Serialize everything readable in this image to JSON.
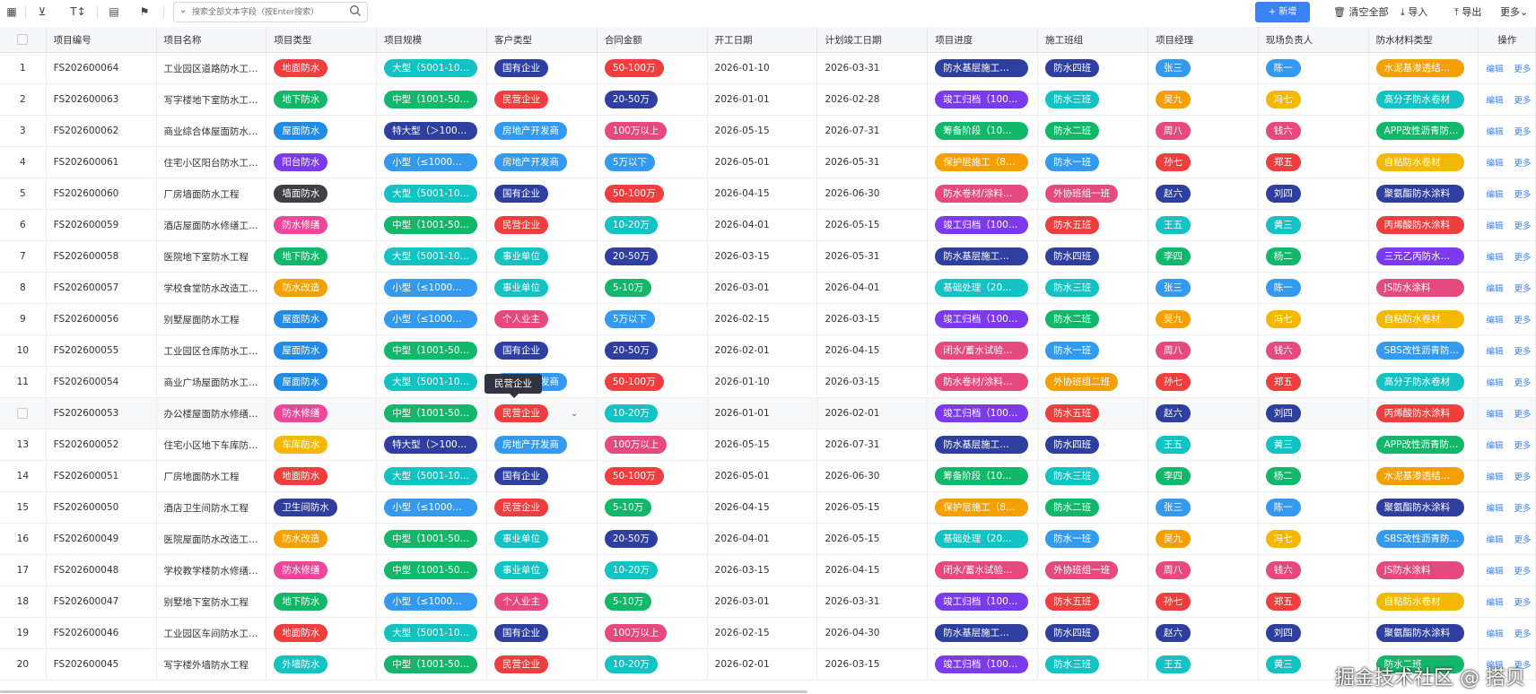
{
  "toolbar": {
    "search_placeholder": "搜索全部文本字段（按Enter搜索）",
    "new_label": "+ 新增",
    "clear_label": "清空全部",
    "import_label": "导入",
    "export_label": "导出",
    "more_label": "更多"
  },
  "columns": [
    "项目编号",
    "项目名称",
    "项目类型",
    "项目规模",
    "客户类型",
    "合同金额",
    "开工日期",
    "计划竣工日期",
    "项目进度",
    "施工班组",
    "项目经理",
    "现场负责人",
    "防水材料类型",
    "操作"
  ],
  "actions": {
    "edit": "编辑",
    "more": "更多"
  },
  "tooltip": "民营企业",
  "watermark": "掘金技术社区 @ 搭贝",
  "colors": {
    "地面防水": "#f03e3e",
    "地下防水": "#12b76a",
    "屋面防水": "#228be6",
    "阳台防水": "#7c3aed",
    "墙面防水": "#3f3f46",
    "防水修缮": "#ec4899",
    "防水改造": "#f59f00",
    "车库防水": "#f5b800",
    "卫生间防水": "#2f3fa0",
    "外墙防水": "#13c2c2",
    "大型（5001-10…": "#13c2c2",
    "中型（1001-50…": "#12b76a",
    "特大型（＞100…": "#2f3fa0",
    "小型（≤1000…": "#339af0",
    "国有企业": "#2f3fa0",
    "民营企业": "#f03e3e",
    "房地产开发商": "#339af0",
    "事业单位": "#13c2c2",
    "个人业主": "#e64980",
    "50-100万": "#f03e3e",
    "20-50万": "#2f3fa0",
    "100万以上": "#e64980",
    "5万以下": "#339af0",
    "10-20万": "#13c2c2",
    "5-10万": "#12b76a",
    "防水基层施工…": "#2f3fa0",
    "竣工归档（100…": "#7c3aed",
    "筹备阶段（10…": "#12b76a",
    "保护层施工（8…": "#f59f00",
    "防水卷材/涂料…": "#e64980",
    "基础处理（20…": "#13c2c2",
    "闭水/蓄水试验…": "#e64980",
    "防水四班": "#2f3fa0",
    "防水三班": "#13c2c2",
    "防水二班": "#12b76a",
    "防水一班": "#339af0",
    "外协班组一班": "#e64980",
    "防水五班": "#f03e3e",
    "外协班组二班": "#f59f00",
    "张三": "#339af0",
    "吴九": "#f59f00",
    "周八": "#e64980",
    "孙七": "#f03e3e",
    "赵六": "#2f3fa0",
    "王五": "#13c2c2",
    "李四": "#12b76a",
    "陈一": "#339af0",
    "冯七": "#f5b800",
    "钱六": "#e64980",
    "郑五": "#f03e3e",
    "刘四": "#2f3fa0",
    "黄三": "#13c2c2",
    "杨二": "#12b76a",
    "水泥基渗透结…": "#f59f00",
    "高分子防水卷材": "#13c2c2",
    "APP改性沥青防…": "#12b76a",
    "自粘防水卷材": "#f5b800",
    "聚氨酯防水涂料": "#2f3fa0",
    "丙烯酸防水涂料": "#f03e3e",
    "三元乙丙防水…": "#7c3aed",
    "JS防水涂料": "#e64980",
    "SBS改性沥青防…": "#339af0"
  },
  "rows": [
    {
      "n": "1",
      "code": "FS202600064",
      "name": "工业园区道路防水工…",
      "type": "地面防水",
      "scale": "大型（5001-10…",
      "client": "国有企业",
      "amount": "50-100万",
      "start": "2026-01-10",
      "end": "2026-03-31",
      "progress": "防水基层施工…",
      "team": "防水四班",
      "pm": "张三",
      "site": "陈一",
      "mat": "水泥基渗透结…"
    },
    {
      "n": "2",
      "code": "FS202600063",
      "name": "写字楼地下室防水工…",
      "type": "地下防水",
      "scale": "中型（1001-50…",
      "client": "民营企业",
      "amount": "20-50万",
      "start": "2026-01-01",
      "end": "2026-02-28",
      "progress": "竣工归档（100…",
      "team": "防水三班",
      "pm": "吴九",
      "site": "冯七",
      "mat": "高分子防水卷材"
    },
    {
      "n": "3",
      "code": "FS202600062",
      "name": "商业综合体屋面防水…",
      "type": "屋面防水",
      "scale": "特大型（＞100…",
      "client": "房地产开发商",
      "amount": "100万以上",
      "start": "2026-05-15",
      "end": "2026-07-31",
      "progress": "筹备阶段（10…",
      "team": "防水二班",
      "pm": "周八",
      "site": "钱六",
      "mat": "APP改性沥青防…"
    },
    {
      "n": "4",
      "code": "FS202600061",
      "name": "住宅小区阳台防水工…",
      "type": "阳台防水",
      "scale": "小型（≤1000…",
      "client": "房地产开发商",
      "amount": "5万以下",
      "start": "2026-05-01",
      "end": "2026-05-31",
      "progress": "保护层施工（8…",
      "team": "防水一班",
      "pm": "孙七",
      "site": "郑五",
      "mat": "自粘防水卷材"
    },
    {
      "n": "5",
      "code": "FS202600060",
      "name": "厂房墙面防水工程",
      "type": "墙面防水",
      "scale": "大型（5001-10…",
      "client": "国有企业",
      "amount": "50-100万",
      "start": "2026-04-15",
      "end": "2026-06-30",
      "progress": "防水卷材/涂料…",
      "team": "外协班组一班",
      "pm": "赵六",
      "site": "刘四",
      "mat": "聚氨酯防水涂料"
    },
    {
      "n": "6",
      "code": "FS202600059",
      "name": "酒店屋面防水修缮工…",
      "type": "防水修缮",
      "scale": "中型（1001-50…",
      "client": "民营企业",
      "amount": "10-20万",
      "start": "2026-04-01",
      "end": "2026-05-15",
      "progress": "竣工归档（100…",
      "team": "防水五班",
      "pm": "王五",
      "site": "黄三",
      "mat": "丙烯酸防水涂料"
    },
    {
      "n": "7",
      "code": "FS202600058",
      "name": "医院地下室防水工程",
      "type": "地下防水",
      "scale": "大型（5001-10…",
      "client": "事业单位",
      "amount": "20-50万",
      "start": "2026-03-15",
      "end": "2026-05-31",
      "progress": "防水基层施工…",
      "team": "防水四班",
      "pm": "李四",
      "site": "杨二",
      "mat": "三元乙丙防水…"
    },
    {
      "n": "8",
      "code": "FS202600057",
      "name": "学校食堂防水改造工…",
      "type": "防水改造",
      "scale": "小型（≤1000…",
      "client": "事业单位",
      "amount": "5-10万",
      "start": "2026-03-01",
      "end": "2026-04-01",
      "progress": "基础处理（20…",
      "team": "防水三班",
      "pm": "张三",
      "site": "陈一",
      "mat": "JS防水涂料"
    },
    {
      "n": "9",
      "code": "FS202600056",
      "name": "别墅屋面防水工程",
      "type": "屋面防水",
      "scale": "小型（≤1000…",
      "client": "个人业主",
      "amount": "5万以下",
      "start": "2026-02-15",
      "end": "2026-03-15",
      "progress": "竣工归档（100…",
      "team": "防水二班",
      "pm": "吴九",
      "site": "冯七",
      "mat": "自粘防水卷材"
    },
    {
      "n": "10",
      "code": "FS202600055",
      "name": "工业园区仓库防水工…",
      "type": "屋面防水",
      "scale": "中型（1001-50…",
      "client": "国有企业",
      "amount": "20-50万",
      "start": "2026-02-01",
      "end": "2026-04-15",
      "progress": "闭水/蓄水试验…",
      "team": "防水一班",
      "pm": "周八",
      "site": "钱六",
      "mat": "SBS改性沥青防…"
    },
    {
      "n": "11",
      "code": "FS202600054",
      "name": "商业广场屋面防水工…",
      "type": "屋面防水",
      "scale": "大型（5001-10…",
      "client": "房地产开发商",
      "amount": "50-100万",
      "start": "2026-01-10",
      "end": "2026-03-15",
      "progress": "防水卷材/涂料…",
      "team": "外协班组二班",
      "pm": "孙七",
      "site": "郑五",
      "mat": "高分子防水卷材"
    },
    {
      "n": "",
      "code": "FS202600053",
      "name": "办公楼屋面防水修缮…",
      "type": "防水修缮",
      "scale": "中型（1001-50…",
      "client": "民营企业",
      "amount": "10-20万",
      "start": "2026-01-01",
      "end": "2026-02-01",
      "progress": "竣工归档（100…",
      "team": "防水五班",
      "pm": "赵六",
      "site": "刘四",
      "mat": "丙烯酸防水涂料"
    },
    {
      "n": "13",
      "code": "FS202600052",
      "name": "住宅小区地下车库防…",
      "type": "车库防水",
      "scale": "特大型（＞100…",
      "client": "房地产开发商",
      "amount": "100万以上",
      "start": "2026-05-15",
      "end": "2026-07-31",
      "progress": "防水基层施工…",
      "team": "防水四班",
      "pm": "王五",
      "site": "黄三",
      "mat": "APP改性沥青防…"
    },
    {
      "n": "14",
      "code": "FS202600051",
      "name": "厂房地面防水工程",
      "type": "地面防水",
      "scale": "大型（5001-10…",
      "client": "国有企业",
      "amount": "50-100万",
      "start": "2026-05-01",
      "end": "2026-06-30",
      "progress": "筹备阶段（10…",
      "team": "防水三班",
      "pm": "李四",
      "site": "杨二",
      "mat": "水泥基渗透结…"
    },
    {
      "n": "15",
      "code": "FS202600050",
      "name": "酒店卫生间防水工程",
      "type": "卫生间防水",
      "scale": "小型（≤1000…",
      "client": "民营企业",
      "amount": "5-10万",
      "start": "2026-04-15",
      "end": "2026-05-15",
      "progress": "保护层施工（8…",
      "team": "防水二班",
      "pm": "张三",
      "site": "陈一",
      "mat": "聚氨酯防水涂料"
    },
    {
      "n": "16",
      "code": "FS202600049",
      "name": "医院屋面防水改造工…",
      "type": "防水改造",
      "scale": "中型（1001-50…",
      "client": "事业单位",
      "amount": "20-50万",
      "start": "2026-04-01",
      "end": "2026-05-15",
      "progress": "基础处理（20…",
      "team": "防水一班",
      "pm": "吴九",
      "site": "冯七",
      "mat": "SBS改性沥青防…"
    },
    {
      "n": "17",
      "code": "FS202600048",
      "name": "学校教学楼防水修缮…",
      "type": "防水修缮",
      "scale": "中型（1001-50…",
      "client": "事业单位",
      "amount": "10-20万",
      "start": "2026-03-15",
      "end": "2026-04-15",
      "progress": "闭水/蓄水试验…",
      "team": "外协班组一班",
      "pm": "周八",
      "site": "钱六",
      "mat": "JS防水涂料"
    },
    {
      "n": "18",
      "code": "FS202600047",
      "name": "别墅地下室防水工程",
      "type": "地下防水",
      "scale": "小型（≤1000…",
      "client": "个人业主",
      "amount": "5-10万",
      "start": "2026-03-01",
      "end": "2026-03-31",
      "progress": "竣工归档（100…",
      "team": "防水五班",
      "pm": "孙七",
      "site": "郑五",
      "mat": "自粘防水卷材"
    },
    {
      "n": "19",
      "code": "FS202600046",
      "name": "工业园区车间防水工…",
      "type": "地面防水",
      "scale": "大型（5001-10…",
      "client": "国有企业",
      "amount": "100万以上",
      "start": "2026-02-15",
      "end": "2026-04-30",
      "progress": "防水基层施工…",
      "team": "防水四班",
      "pm": "赵六",
      "site": "刘四",
      "mat": "聚氨酯防水涂料"
    },
    {
      "n": "20",
      "code": "FS202600045",
      "name": "写字楼外墙防水工程",
      "type": "外墙防水",
      "scale": "中型（1001-50…",
      "client": "民营企业",
      "amount": "10-20万",
      "start": "2026-02-01",
      "end": "2026-03-15",
      "progress": "竣工归档（100…",
      "team": "防水三班",
      "pm": "王五",
      "site": "黄三",
      "mat": "防水二班"
    }
  ]
}
